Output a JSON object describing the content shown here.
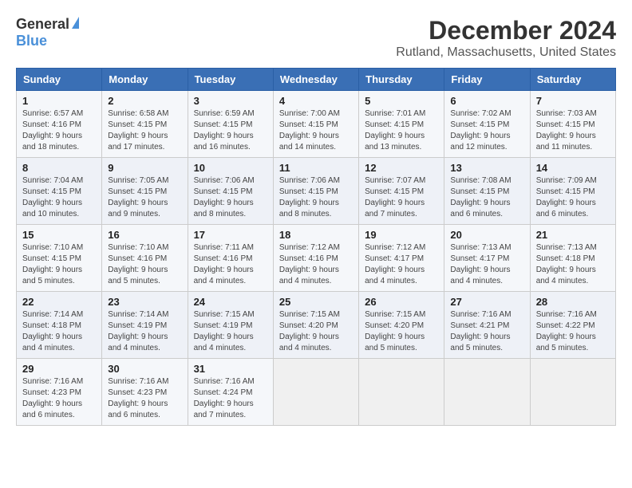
{
  "title": "December 2024",
  "subtitle": "Rutland, Massachusetts, United States",
  "logo": {
    "general": "General",
    "blue": "Blue"
  },
  "days_of_week": [
    "Sunday",
    "Monday",
    "Tuesday",
    "Wednesday",
    "Thursday",
    "Friday",
    "Saturday"
  ],
  "weeks": [
    [
      {
        "day": "1",
        "info": "Sunrise: 6:57 AM\nSunset: 4:16 PM\nDaylight: 9 hours and 18 minutes."
      },
      {
        "day": "2",
        "info": "Sunrise: 6:58 AM\nSunset: 4:15 PM\nDaylight: 9 hours and 17 minutes."
      },
      {
        "day": "3",
        "info": "Sunrise: 6:59 AM\nSunset: 4:15 PM\nDaylight: 9 hours and 16 minutes."
      },
      {
        "day": "4",
        "info": "Sunrise: 7:00 AM\nSunset: 4:15 PM\nDaylight: 9 hours and 14 minutes."
      },
      {
        "day": "5",
        "info": "Sunrise: 7:01 AM\nSunset: 4:15 PM\nDaylight: 9 hours and 13 minutes."
      },
      {
        "day": "6",
        "info": "Sunrise: 7:02 AM\nSunset: 4:15 PM\nDaylight: 9 hours and 12 minutes."
      },
      {
        "day": "7",
        "info": "Sunrise: 7:03 AM\nSunset: 4:15 PM\nDaylight: 9 hours and 11 minutes."
      }
    ],
    [
      {
        "day": "8",
        "info": "Sunrise: 7:04 AM\nSunset: 4:15 PM\nDaylight: 9 hours and 10 minutes."
      },
      {
        "day": "9",
        "info": "Sunrise: 7:05 AM\nSunset: 4:15 PM\nDaylight: 9 hours and 9 minutes."
      },
      {
        "day": "10",
        "info": "Sunrise: 7:06 AM\nSunset: 4:15 PM\nDaylight: 9 hours and 8 minutes."
      },
      {
        "day": "11",
        "info": "Sunrise: 7:06 AM\nSunset: 4:15 PM\nDaylight: 9 hours and 8 minutes."
      },
      {
        "day": "12",
        "info": "Sunrise: 7:07 AM\nSunset: 4:15 PM\nDaylight: 9 hours and 7 minutes."
      },
      {
        "day": "13",
        "info": "Sunrise: 7:08 AM\nSunset: 4:15 PM\nDaylight: 9 hours and 6 minutes."
      },
      {
        "day": "14",
        "info": "Sunrise: 7:09 AM\nSunset: 4:15 PM\nDaylight: 9 hours and 6 minutes."
      }
    ],
    [
      {
        "day": "15",
        "info": "Sunrise: 7:10 AM\nSunset: 4:15 PM\nDaylight: 9 hours and 5 minutes."
      },
      {
        "day": "16",
        "info": "Sunrise: 7:10 AM\nSunset: 4:16 PM\nDaylight: 9 hours and 5 minutes."
      },
      {
        "day": "17",
        "info": "Sunrise: 7:11 AM\nSunset: 4:16 PM\nDaylight: 9 hours and 4 minutes."
      },
      {
        "day": "18",
        "info": "Sunrise: 7:12 AM\nSunset: 4:16 PM\nDaylight: 9 hours and 4 minutes."
      },
      {
        "day": "19",
        "info": "Sunrise: 7:12 AM\nSunset: 4:17 PM\nDaylight: 9 hours and 4 minutes."
      },
      {
        "day": "20",
        "info": "Sunrise: 7:13 AM\nSunset: 4:17 PM\nDaylight: 9 hours and 4 minutes."
      },
      {
        "day": "21",
        "info": "Sunrise: 7:13 AM\nSunset: 4:18 PM\nDaylight: 9 hours and 4 minutes."
      }
    ],
    [
      {
        "day": "22",
        "info": "Sunrise: 7:14 AM\nSunset: 4:18 PM\nDaylight: 9 hours and 4 minutes."
      },
      {
        "day": "23",
        "info": "Sunrise: 7:14 AM\nSunset: 4:19 PM\nDaylight: 9 hours and 4 minutes."
      },
      {
        "day": "24",
        "info": "Sunrise: 7:15 AM\nSunset: 4:19 PM\nDaylight: 9 hours and 4 minutes."
      },
      {
        "day": "25",
        "info": "Sunrise: 7:15 AM\nSunset: 4:20 PM\nDaylight: 9 hours and 4 minutes."
      },
      {
        "day": "26",
        "info": "Sunrise: 7:15 AM\nSunset: 4:20 PM\nDaylight: 9 hours and 5 minutes."
      },
      {
        "day": "27",
        "info": "Sunrise: 7:16 AM\nSunset: 4:21 PM\nDaylight: 9 hours and 5 minutes."
      },
      {
        "day": "28",
        "info": "Sunrise: 7:16 AM\nSunset: 4:22 PM\nDaylight: 9 hours and 5 minutes."
      }
    ],
    [
      {
        "day": "29",
        "info": "Sunrise: 7:16 AM\nSunset: 4:23 PM\nDaylight: 9 hours and 6 minutes."
      },
      {
        "day": "30",
        "info": "Sunrise: 7:16 AM\nSunset: 4:23 PM\nDaylight: 9 hours and 6 minutes."
      },
      {
        "day": "31",
        "info": "Sunrise: 7:16 AM\nSunset: 4:24 PM\nDaylight: 9 hours and 7 minutes."
      },
      null,
      null,
      null,
      null
    ]
  ]
}
